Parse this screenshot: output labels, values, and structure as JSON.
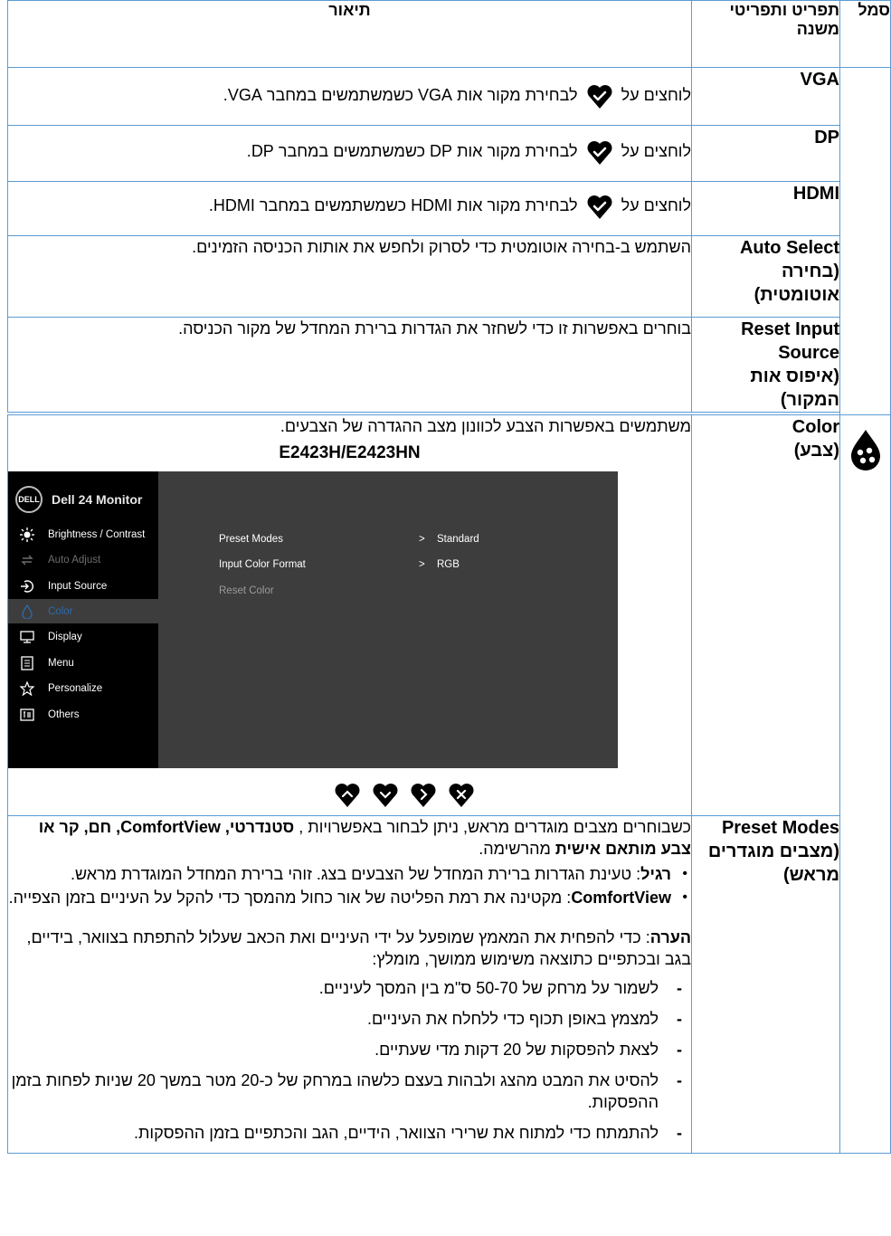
{
  "header": {
    "symbol": "סמל",
    "item": "תפריט ותפריטי משנה",
    "description": "תיאור"
  },
  "rows": {
    "vga": {
      "item": "VGA",
      "pre": "לוחצים על",
      "post": "לבחירת מקור אות VGA כשמשתמשים במחבר VGA."
    },
    "dp": {
      "item": "DP",
      "pre": "לוחצים על",
      "post": "לבחירת מקור אות DP כשמשתמשים במחבר DP."
    },
    "hdmi": {
      "item": "HDMI",
      "pre": "לוחצים על",
      "post": "לבחירת מקור אות HDMI כשמשתמשים במחבר HDMI."
    },
    "auto_select": {
      "item_en": "Auto Select",
      "item_he": "(בחירה אוטומטית)",
      "desc": "השתמש ב-בחירה אוטומטית כדי לסרוק ולחפש את אותות הכניסה הזמינים."
    },
    "reset_input": {
      "item_en": "Reset Input Source",
      "item_he": "(איפוס אות המקור)",
      "desc": "בוחרים באפשרות זו כדי לשחזר את הגדרות ברירת המחדל של מקור הכניסה."
    },
    "color": {
      "item_en": "Color",
      "item_he": "(צבע)",
      "desc": "משתמשים באפשרות הצבע לכוונון מצב ההגדרה של הצבעים.",
      "model": "E2423H/E2423HN"
    },
    "preset": {
      "item_en": "Preset Modes",
      "item_he": "(מצבים מוגדרים מראש)",
      "intro_a": "כשבוחרים מצבים מוגדרים מראש, ניתן לבחור באפשרויות ,",
      "intro_b": "סטנדרטי, ComfortView, חם, קר או צבע מותאם אישית",
      "intro_c": "מהרשימה.",
      "bullet1_term": "רגיל",
      "bullet1_text": ": טעינת הגדרות ברירת המחדל של הצבעים בצג. זוהי ברירת המחדל המוגדרת מראש.",
      "bullet2_term": "ComfortView",
      "bullet2_text": ": מקטינה את רמת הפליטה של אור כחול מהמסך כדי להקל על העיניים בזמן הצפייה.",
      "note_term": "הערה",
      "note_text": ": כדי להפחית את המאמץ שמופעל על ידי העיניים ואת הכאב שעלול להתפתח בצוואר, בידיים, בגב ובכתפיים כתוצאה משימוש ממושך, מומלץ:",
      "tips": [
        "לשמור על מרחק של 50-70 ס\"מ בין המסך לעיניים.",
        "למצמץ באופן תכוף כדי ללחלח את העיניים.",
        "לצאת להפסקות של 20 דקות מדי שעתיים.",
        "להסיט את המבט מהצג ולבהות בעצם כלשהו במרחק של כ-20 מטר במשך 20 שניות לפחות בזמן ההפסקות.",
        "להתמתח כדי למתוח את שרירי הצוואר, הידיים, הגב והכתפיים בזמן ההפסקות."
      ]
    }
  },
  "osd": {
    "logo": "DELL",
    "title": "Dell 24 Monitor",
    "menu": [
      {
        "label": "Brightness / Contrast",
        "icon": "brightness-icon"
      },
      {
        "label": "Auto Adjust",
        "icon": "auto-adjust-icon"
      },
      {
        "label": "Input Source",
        "icon": "input-source-icon"
      },
      {
        "label": "Color",
        "icon": "color-icon"
      },
      {
        "label": "Display",
        "icon": "display-icon"
      },
      {
        "label": "Menu",
        "icon": "menu-icon"
      },
      {
        "label": "Personalize",
        "icon": "star-icon"
      },
      {
        "label": "Others",
        "icon": "others-icon"
      }
    ],
    "options": [
      {
        "label": "Preset Modes",
        "value": "Standard"
      },
      {
        "label": "Input Color Format",
        "value": "RGB"
      },
      {
        "label": "Reset Color",
        "value": ""
      }
    ],
    "arrow": ">"
  },
  "colors": {
    "border": "#5b9bd5",
    "osd_bg": "#3d3d3d",
    "osd_side": "#000000",
    "selected_text": "#2f6aa8"
  },
  "nav_buttons": [
    "up-icon",
    "down-icon",
    "right-icon",
    "close-icon"
  ]
}
